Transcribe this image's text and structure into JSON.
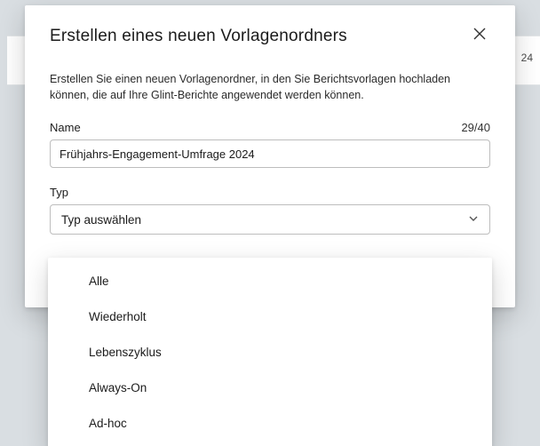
{
  "background": {
    "row_number": "24"
  },
  "modal": {
    "title": "Erstellen eines neuen Vorlagenordners",
    "description": "Erstellen Sie einen neuen Vorlagenordner, in den Sie Berichtsvorlagen hochladen können, die auf Ihre Glint-Berichte angewendet werden können.",
    "name_field": {
      "label": "Name",
      "value": "Frühjahrs-Engagement-Umfrage 2024",
      "counter": "29/40"
    },
    "type_field": {
      "label": "Typ",
      "placeholder": "Typ auswählen",
      "options": [
        "Alle",
        "Wiederholt",
        "Lebenszyklus",
        "Always-On",
        "Ad-hoc"
      ]
    }
  }
}
